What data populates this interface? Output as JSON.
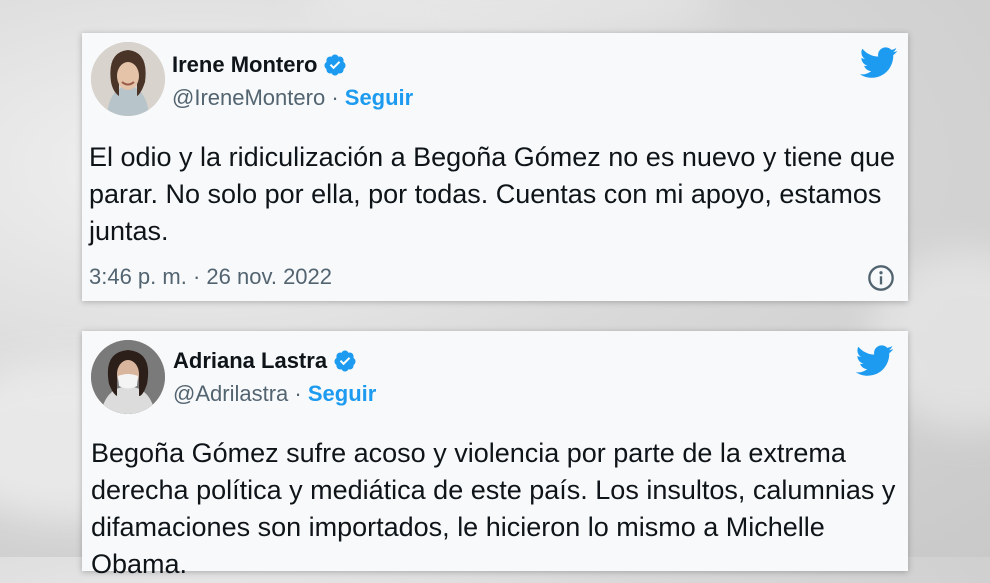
{
  "tweets": [
    {
      "name": "Irene Montero",
      "handle": "@IreneMontero",
      "separator": "·",
      "follow_label": "Seguir",
      "text": "El odio y la ridiculización a Begoña Gómez no es nuevo y tiene que parar. No solo por ella, por todas. Cuentas con mi apoyo, estamos juntas.",
      "time": "3:46 p. m.",
      "date": "26 nov. 2022",
      "meta_separator": "·"
    },
    {
      "name": "Adriana Lastra",
      "handle": "@Adrilastra",
      "separator": "·",
      "follow_label": "Seguir",
      "text": "Begoña Gómez sufre acoso y violencia por parte de la extrema derecha política y mediática de este país. Los insultos, calumnias y difamaciones son importados, le hicieron lo mismo a Michelle Obama."
    }
  ],
  "icons": {
    "verified": "verified-badge-icon",
    "brand": "twitter-bird-icon",
    "info": "info-icon"
  },
  "colors": {
    "accent": "#1d9bf0",
    "text": "#0f1419",
    "secondary": "#536471"
  }
}
